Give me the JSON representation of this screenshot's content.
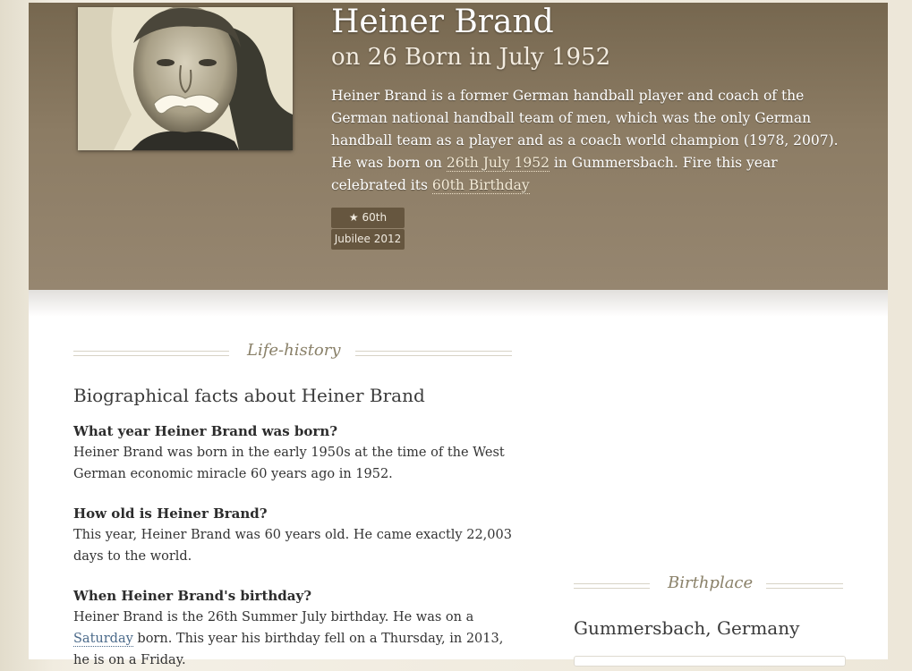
{
  "hero": {
    "name": "Heiner Brand",
    "subtitle": "on 26 Born in July 1952",
    "intro_part1": "Heiner Brand is a former German handball player and coach of the German national handball team of men, which was the only German handball team as a player and as a coach world champion (1978, 2007). He was born on ",
    "birth_link": "26th July 1952",
    "intro_part2": " in Gummersbach. Fire this year celebrated its ",
    "birthday_link": "60th Birthday",
    "intro_part3": ".",
    "badge_top": "★ 60th",
    "badge_bottom": "Jubilee 2012",
    "photo_alt": "portrait photo of Heiner Brand"
  },
  "life_history": {
    "section_title": "Life-history",
    "heading": "Biographical facts about Heiner Brand",
    "faqs": [
      {
        "question": "What year Heiner Brand was born?",
        "answer": "Heiner Brand was born in the early 1950s at the time of the West German economic miracle 60 years ago in 1952."
      },
      {
        "question": "How old is Heiner Brand?",
        "answer": "This year, Heiner Brand was 60 years old. He came exactly 22,003 days to the world."
      },
      {
        "question": "When Heiner Brand's birthday?",
        "answer_part1": "Heiner Brand is the 26th Summer July birthday. He was on a ",
        "answer_link": "Saturday",
        "answer_part2": " born. This year his birthday fell on a Thursday, in 2013, he is on a Friday."
      }
    ]
  },
  "birthplace": {
    "section_title": "Birthplace",
    "place": "Gummersbach, Germany"
  }
}
